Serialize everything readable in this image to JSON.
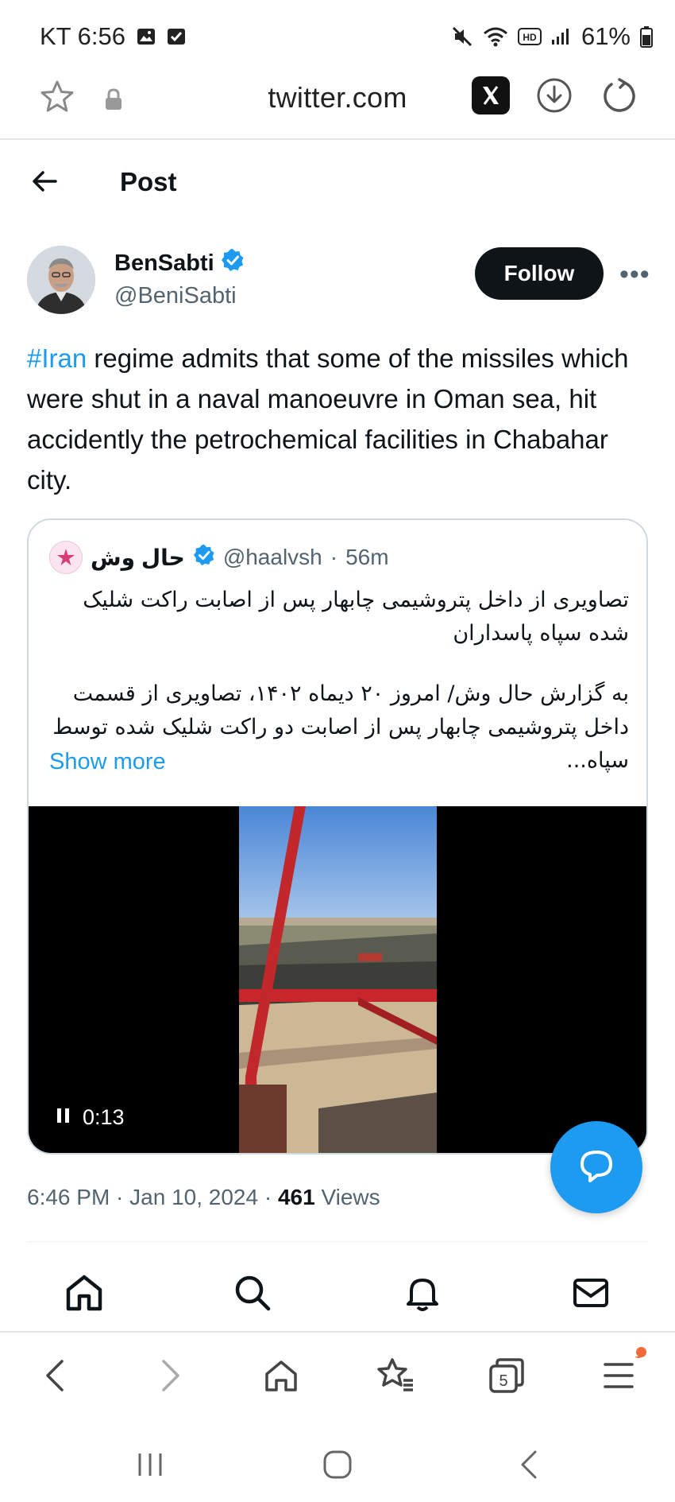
{
  "status_bar": {
    "carrier_time": "KT 6:56",
    "battery": "61%",
    "icons": [
      "gallery-icon",
      "check-icon",
      "mute-icon",
      "wifi-icon",
      "hd-icon",
      "signal-icon",
      "battery-icon"
    ]
  },
  "browser": {
    "url": "twitter.com"
  },
  "page": {
    "title": "Post"
  },
  "author": {
    "name": "BenSabti",
    "handle": "@BeniSabti",
    "follow_label": "Follow",
    "more_label": "•••"
  },
  "tweet": {
    "hashtag": "#Iran",
    "text": " regime admits that some of the missiles which were shut in a naval manoeuvre in Oman sea, hit accidently the petrochemical facilities in Chabahar city."
  },
  "quote": {
    "name": "حال وش",
    "handle": "@haalvsh",
    "separator": "·",
    "time": "56m",
    "paragraph1": "تصاویری از داخل پتروشیمی چابهار پس از اصابت راکت شلیک شده سپاه پاسداران",
    "paragraph2": "به گزارش حال وش/ امروز ۲۰ دیماه ۱۴۰۲، تصاویری از قسمت داخل پتروشیمی چابهار پس از اصابت دو راکت شلیک شده توسط سپاه...",
    "show_more": "Show more",
    "video_time": "0:13"
  },
  "meta": {
    "timestamp": "6:46 PM · Jan 10, 2024 · ",
    "views_count": "461",
    "views_label": " Views"
  },
  "colors": {
    "accent": "#1d9bf0",
    "text": "#0f1419",
    "muted": "#536471"
  }
}
